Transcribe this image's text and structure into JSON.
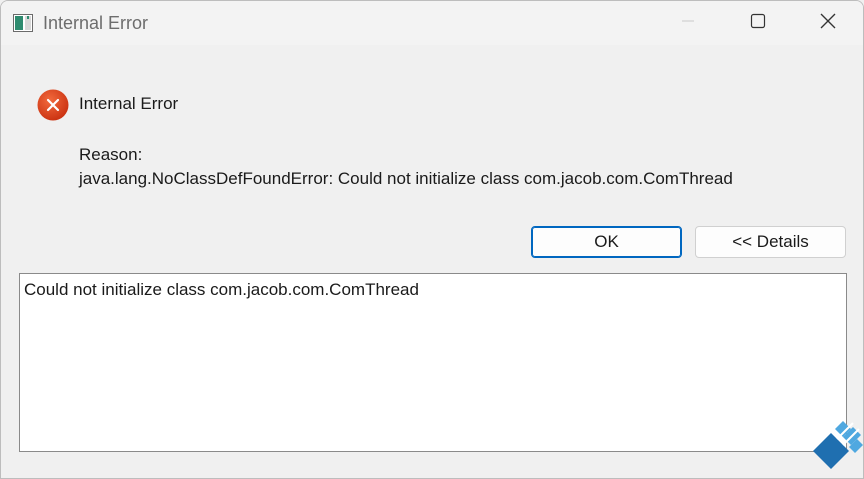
{
  "window": {
    "title": "Internal Error",
    "controls": {
      "minimize_icon": "minimize-icon",
      "maximize_icon": "maximize-icon",
      "close_icon": "close-icon"
    }
  },
  "dialog": {
    "icon": "error-icon",
    "heading": "Internal Error",
    "reason_label": "Reason:",
    "reason_text": "java.lang.NoClassDefFoundError: Could not initialize class com.jacob.com.ComThread",
    "ok_label": "OK",
    "details_label": "<< Details",
    "details_text": "Could not initialize class com.jacob.com.ComThread"
  },
  "colors": {
    "accent": "#0067c0",
    "error": "#e0441b",
    "background": "#f0f0f0"
  }
}
